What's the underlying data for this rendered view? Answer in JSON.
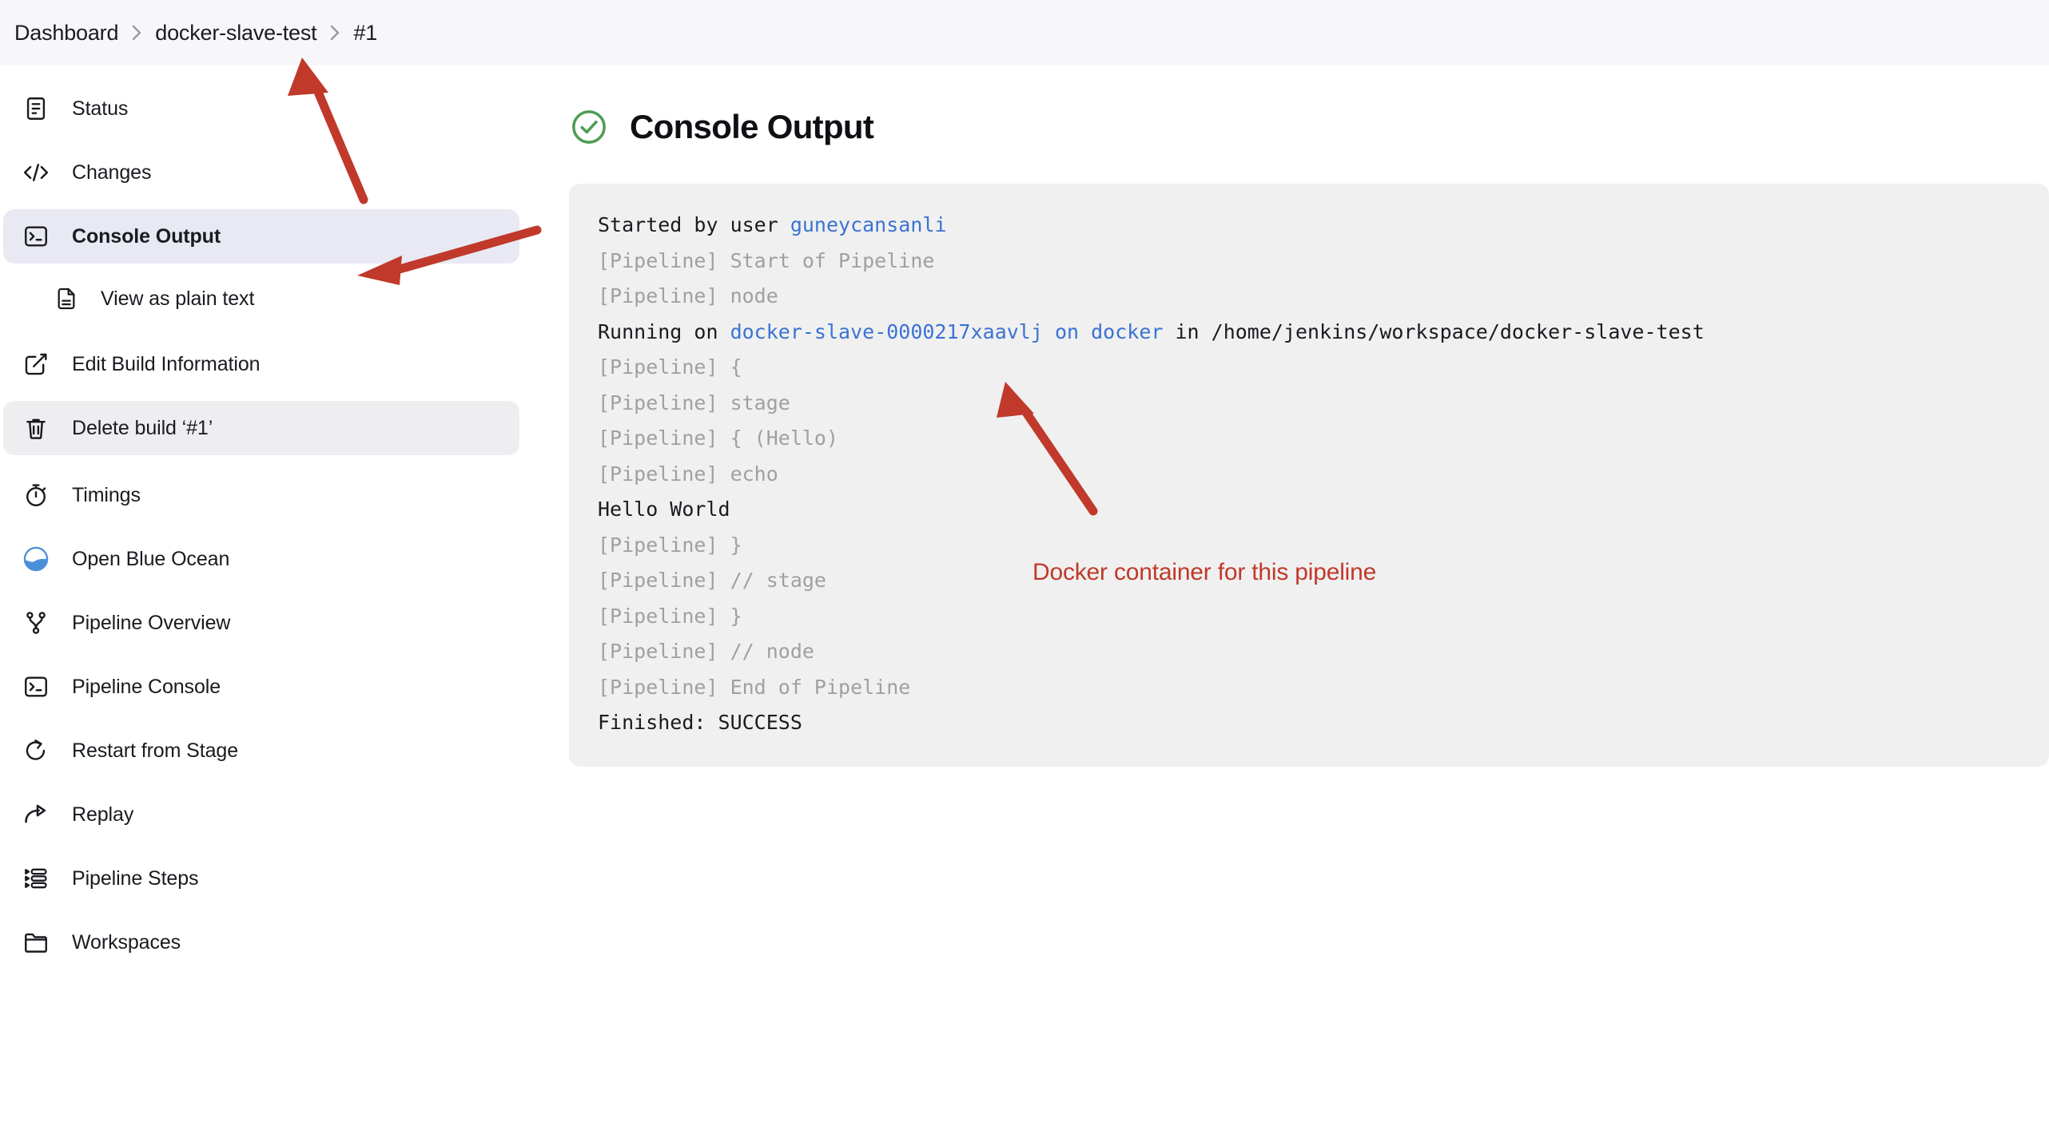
{
  "breadcrumb": {
    "items": [
      {
        "label": "Dashboard"
      },
      {
        "label": "docker-slave-test"
      },
      {
        "label": "#1"
      }
    ]
  },
  "sidebar": {
    "items": [
      {
        "label": "Status",
        "icon": "document-status-icon",
        "state": "normal",
        "level": "top"
      },
      {
        "label": "Changes",
        "icon": "code-brackets-icon",
        "state": "normal",
        "level": "top"
      },
      {
        "label": "Console Output",
        "icon": "terminal-icon",
        "state": "selected",
        "level": "top"
      },
      {
        "label": "View as plain text",
        "icon": "plain-text-file-icon",
        "state": "normal",
        "level": "sub"
      },
      {
        "label": "Edit Build Information",
        "icon": "edit-pencil-icon",
        "state": "normal",
        "level": "top"
      },
      {
        "label": "Delete build ‘#1’",
        "icon": "trash-icon",
        "state": "hovered",
        "level": "top"
      },
      {
        "label": "Timings",
        "icon": "stopwatch-icon",
        "state": "normal",
        "level": "top"
      },
      {
        "label": "Open Blue Ocean",
        "icon": "blue-ocean-icon",
        "state": "normal",
        "level": "top"
      },
      {
        "label": "Pipeline Overview",
        "icon": "git-branch-icon",
        "state": "normal",
        "level": "top"
      },
      {
        "label": "Pipeline Console",
        "icon": "terminal-icon",
        "state": "normal",
        "level": "top"
      },
      {
        "label": "Restart from Stage",
        "icon": "restart-arrow-icon",
        "state": "normal",
        "level": "top"
      },
      {
        "label": "Replay",
        "icon": "replay-share-arrow-icon",
        "state": "normal",
        "level": "top"
      },
      {
        "label": "Pipeline Steps",
        "icon": "steps-list-icon",
        "state": "normal",
        "level": "top"
      },
      {
        "label": "Workspaces",
        "icon": "folder-icon",
        "state": "normal",
        "level": "top"
      }
    ]
  },
  "main": {
    "status": "success",
    "status_icon": "green-check-circle-icon",
    "title": "Console Output",
    "console_lines": [
      {
        "segments": [
          {
            "text": "Started by user ",
            "style": "plain"
          },
          {
            "text": "guneycansanli",
            "style": "link"
          }
        ]
      },
      {
        "segments": [
          {
            "text": "[Pipeline] Start of Pipeline",
            "style": "muted"
          }
        ]
      },
      {
        "segments": [
          {
            "text": "[Pipeline] node",
            "style": "muted"
          }
        ]
      },
      {
        "segments": [
          {
            "text": "Running on ",
            "style": "plain"
          },
          {
            "text": "docker-slave-0000217xaavlj on docker",
            "style": "link"
          },
          {
            "text": " in /home/jenkins/workspace/docker-slave-test",
            "style": "plain"
          }
        ]
      },
      {
        "segments": [
          {
            "text": "[Pipeline] {",
            "style": "muted"
          }
        ]
      },
      {
        "segments": [
          {
            "text": "[Pipeline] stage",
            "style": "muted"
          }
        ]
      },
      {
        "segments": [
          {
            "text": "[Pipeline] { (Hello)",
            "style": "muted"
          }
        ]
      },
      {
        "segments": [
          {
            "text": "[Pipeline] echo",
            "style": "muted"
          }
        ]
      },
      {
        "segments": [
          {
            "text": "Hello World",
            "style": "plain"
          }
        ]
      },
      {
        "segments": [
          {
            "text": "[Pipeline] }",
            "style": "muted"
          }
        ]
      },
      {
        "segments": [
          {
            "text": "[Pipeline] // stage",
            "style": "muted"
          }
        ]
      },
      {
        "segments": [
          {
            "text": "[Pipeline] }",
            "style": "muted"
          }
        ]
      },
      {
        "segments": [
          {
            "text": "[Pipeline] // node",
            "style": "muted"
          }
        ]
      },
      {
        "segments": [
          {
            "text": "[Pipeline] End of Pipeline",
            "style": "muted"
          }
        ]
      },
      {
        "segments": [
          {
            "text": "Finished: SUCCESS",
            "style": "plain"
          }
        ]
      }
    ]
  },
  "annotations": {
    "color": "#c0392b",
    "callout_label": "Docker container for this pipeline",
    "arrows": [
      {
        "name": "arrow-to-breadcrumb-job"
      },
      {
        "name": "arrow-to-console-output-nav"
      },
      {
        "name": "arrow-to-docker-node-link"
      }
    ]
  }
}
